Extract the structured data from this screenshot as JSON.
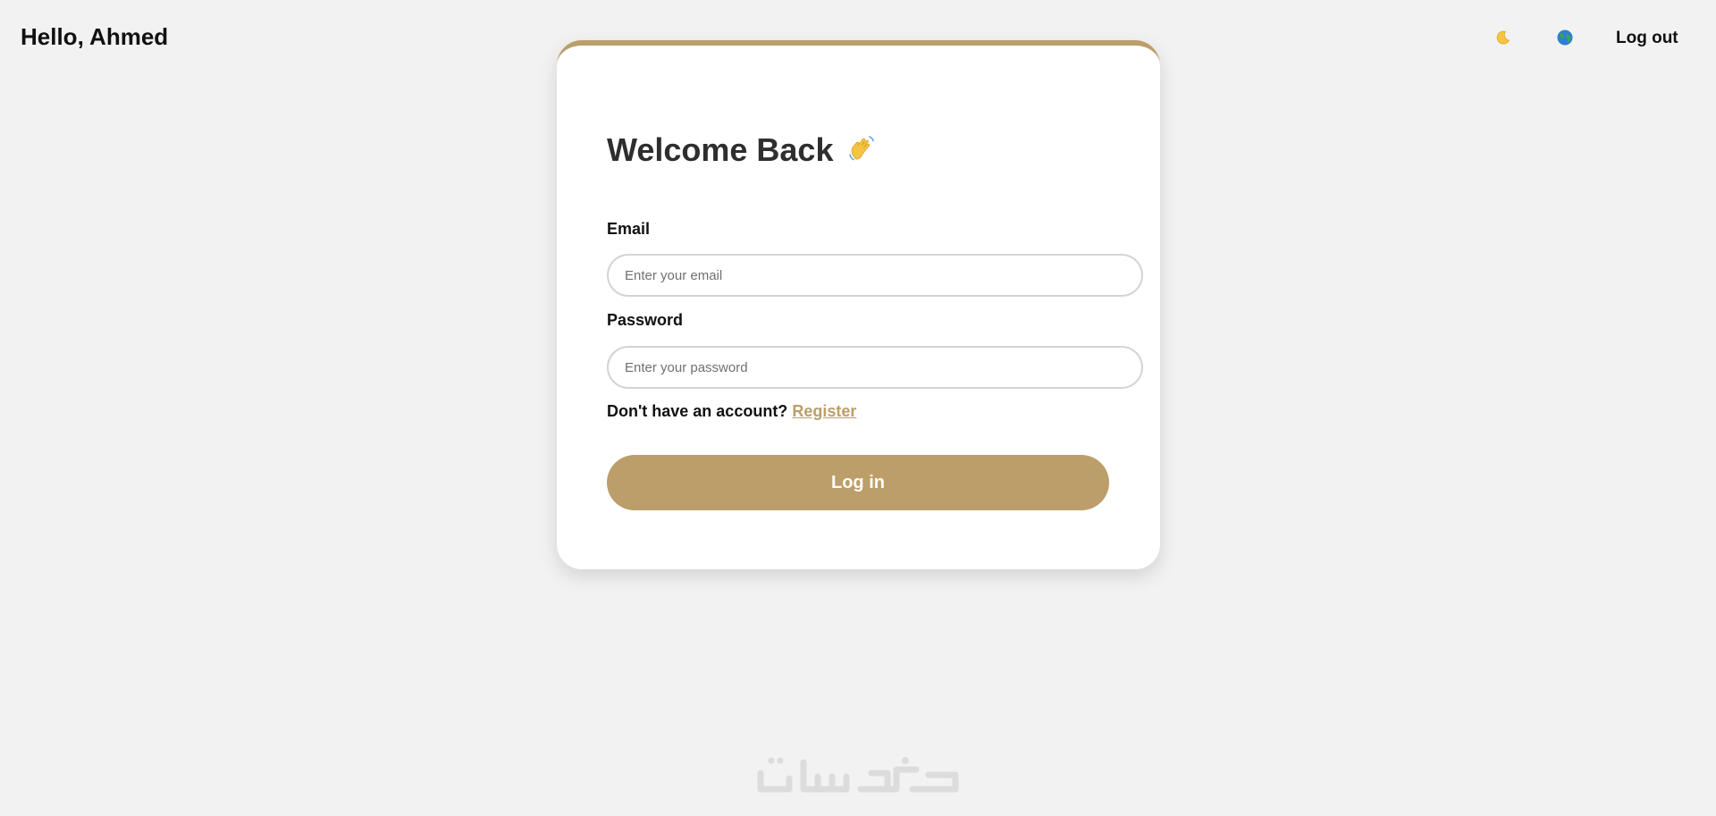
{
  "header": {
    "greeting": "Hello, Ahmed",
    "theme_icon": "moon-icon",
    "language_icon": "globe-icon",
    "logout_label": "Log out"
  },
  "login_card": {
    "title": "Welcome Back",
    "title_icon": "waving-hand-icon",
    "email_label": "Email",
    "email_placeholder": "Enter your email",
    "email_value": "",
    "password_label": "Password",
    "password_placeholder": "Enter your password",
    "password_value": "",
    "register_prompt": "Don't have an account?",
    "register_link": "Register",
    "submit_label": "Log in"
  },
  "footer": {
    "watermark_text": "خمسات"
  },
  "colors": {
    "accent": "#bb9e69",
    "background": "#f2f2f2",
    "card": "#ffffff",
    "text": "#111111"
  }
}
